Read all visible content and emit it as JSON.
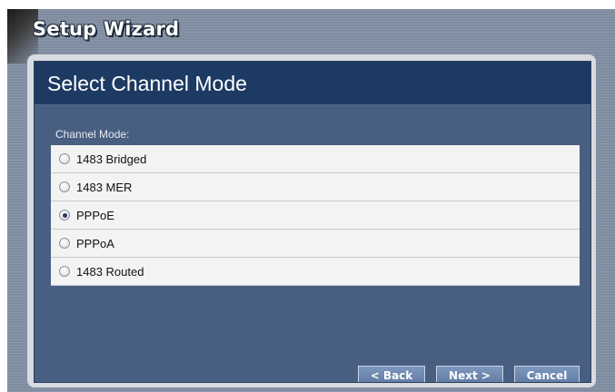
{
  "wizard": {
    "title": "Setup Wizard"
  },
  "panel": {
    "title": "Select Channel Mode"
  },
  "channel_mode": {
    "label": "Channel Mode:",
    "selected": "PPPoE",
    "options": [
      {
        "label": "1483 Bridged",
        "checked": false
      },
      {
        "label": "1483 MER",
        "checked": false
      },
      {
        "label": "PPPoE",
        "checked": true
      },
      {
        "label": "PPPoA",
        "checked": false
      },
      {
        "label": "1483 Routed",
        "checked": false
      }
    ]
  },
  "buttons": {
    "back": "< Back",
    "next": "Next >",
    "cancel": "Cancel"
  }
}
